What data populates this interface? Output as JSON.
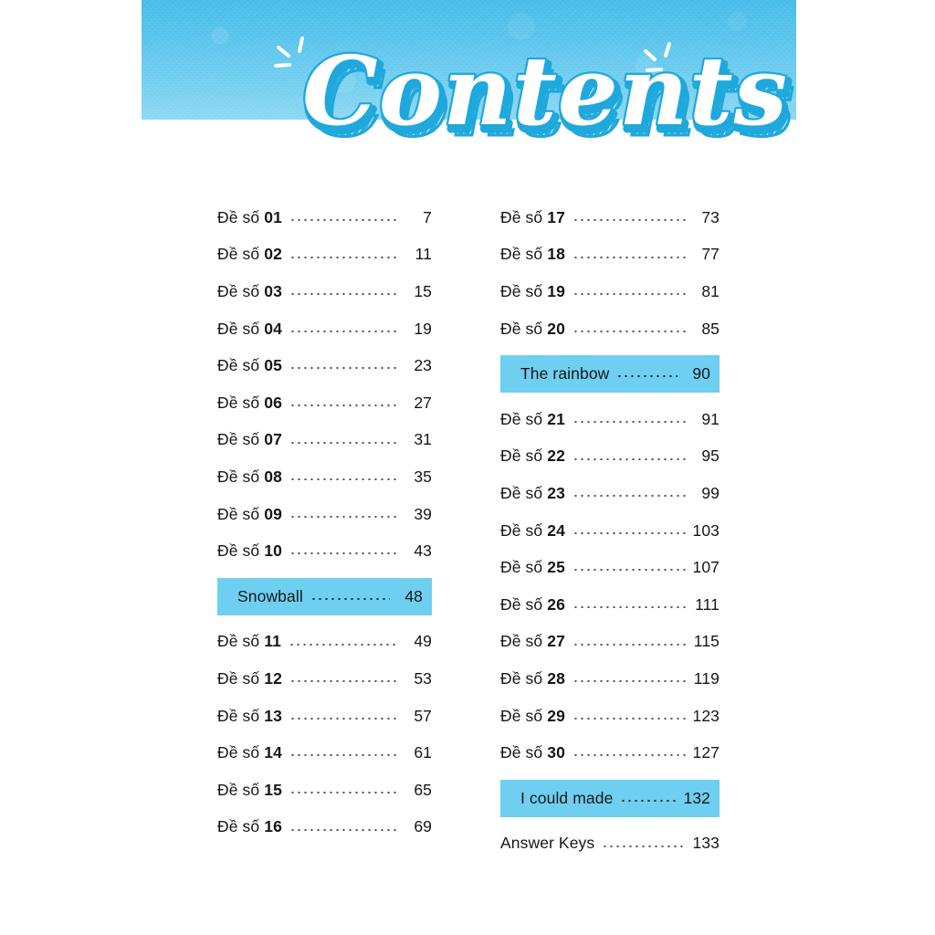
{
  "page": {
    "title": "Contents",
    "background_color": "#ffffff"
  },
  "banner": {
    "gradient_top": "#47BDEA",
    "gradient_bottom": "#8ED9F4",
    "title_text": "Contents",
    "title_fill": "#ffffff",
    "title_outline": "#1FA8DC",
    "sparkle_color": "#ffffff"
  },
  "highlight": {
    "background_color": "#6ECFF0",
    "text_color": "#16161a"
  },
  "toc": {
    "left_column": [
      {
        "label_prefix": "Đề số",
        "label_number": "01",
        "page": "7",
        "highlight": false
      },
      {
        "label_prefix": "Đề số",
        "label_number": "02",
        "page": "11",
        "highlight": false
      },
      {
        "label_prefix": "Đề số",
        "label_number": "03",
        "page": "15",
        "highlight": false
      },
      {
        "label_prefix": "Đề số",
        "label_number": "04",
        "page": "19",
        "highlight": false
      },
      {
        "label_prefix": "Đề số",
        "label_number": "05",
        "page": "23",
        "highlight": false
      },
      {
        "label_prefix": "Đề số",
        "label_number": "06",
        "page": "27",
        "highlight": false
      },
      {
        "label_prefix": "Đề số",
        "label_number": "07",
        "page": "31",
        "highlight": false
      },
      {
        "label_prefix": "Đề số",
        "label_number": "08",
        "page": "35",
        "highlight": false
      },
      {
        "label_prefix": "Đề số",
        "label_number": "09",
        "page": "39",
        "highlight": false
      },
      {
        "label_prefix": "Đề số",
        "label_number": "10",
        "page": "43",
        "highlight": false
      },
      {
        "label_prefix": "Snowball",
        "label_number": "",
        "page": "48",
        "highlight": true
      },
      {
        "label_prefix": "Đề số",
        "label_number": "11",
        "page": "49",
        "highlight": false
      },
      {
        "label_prefix": "Đề số",
        "label_number": "12",
        "page": "53",
        "highlight": false
      },
      {
        "label_prefix": "Đề số",
        "label_number": "13",
        "page": "57",
        "highlight": false
      },
      {
        "label_prefix": "Đề số",
        "label_number": "14",
        "page": "61",
        "highlight": false
      },
      {
        "label_prefix": "Đề số",
        "label_number": "15",
        "page": "65",
        "highlight": false
      },
      {
        "label_prefix": "Đề số",
        "label_number": "16",
        "page": "69",
        "highlight": false
      }
    ],
    "right_column": [
      {
        "label_prefix": "Đề số",
        "label_number": "17",
        "page": "73",
        "highlight": false
      },
      {
        "label_prefix": "Đề số",
        "label_number": "18",
        "page": "77",
        "highlight": false
      },
      {
        "label_prefix": "Đề số",
        "label_number": "19",
        "page": "81",
        "highlight": false
      },
      {
        "label_prefix": "Đề số",
        "label_number": "20",
        "page": "85",
        "highlight": false
      },
      {
        "label_prefix": "The rainbow",
        "label_number": "",
        "page": "90",
        "highlight": true
      },
      {
        "label_prefix": "Đề số",
        "label_number": "21",
        "page": "91",
        "highlight": false
      },
      {
        "label_prefix": "Đề số",
        "label_number": "22",
        "page": "95",
        "highlight": false
      },
      {
        "label_prefix": "Đề số",
        "label_number": "23",
        "page": "99",
        "highlight": false
      },
      {
        "label_prefix": "Đề số",
        "label_number": "24",
        "page": "103",
        "highlight": false
      },
      {
        "label_prefix": "Đề số",
        "label_number": "25",
        "page": "107",
        "highlight": false
      },
      {
        "label_prefix": "Đề số",
        "label_number": "26",
        "page": "111",
        "highlight": false
      },
      {
        "label_prefix": "Đề số",
        "label_number": "27",
        "page": "115",
        "highlight": false
      },
      {
        "label_prefix": "Đề số",
        "label_number": "28",
        "page": "119",
        "highlight": false
      },
      {
        "label_prefix": "Đề số",
        "label_number": "29",
        "page": "123",
        "highlight": false
      },
      {
        "label_prefix": "Đề số",
        "label_number": "30",
        "page": "127",
        "highlight": false
      },
      {
        "label_prefix": "I could made",
        "label_number": "",
        "page": "132",
        "highlight": true
      },
      {
        "label_prefix": "Answer Keys",
        "label_number": "",
        "page": "133",
        "highlight": false
      }
    ]
  }
}
